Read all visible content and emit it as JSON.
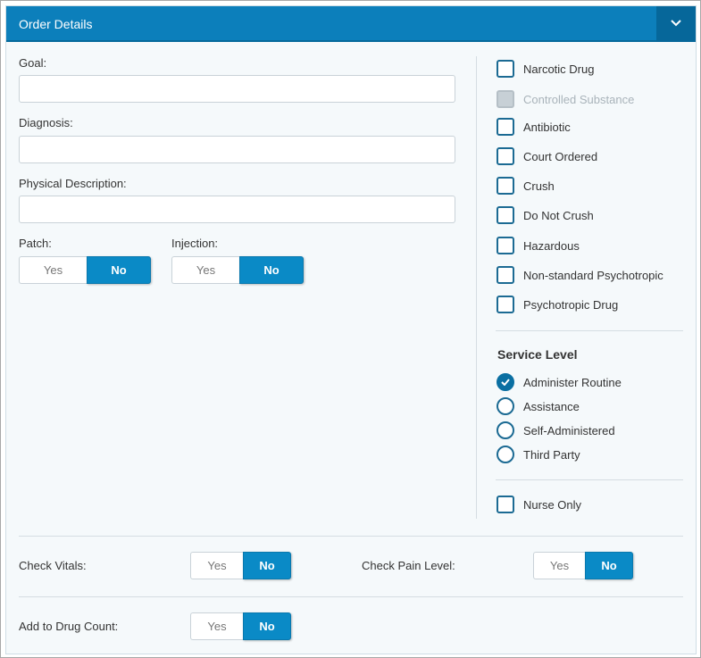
{
  "header": {
    "title": "Order Details",
    "collapse_icon": "chevron-down-icon"
  },
  "fields": {
    "goal": {
      "label": "Goal:",
      "value": ""
    },
    "diagnosis": {
      "label": "Diagnosis:",
      "value": ""
    },
    "physical_description": {
      "label": "Physical Description:",
      "value": ""
    }
  },
  "toggles": {
    "patch": {
      "label": "Patch:",
      "yes": "Yes",
      "no": "No",
      "selected": "No"
    },
    "injection": {
      "label": "Injection:",
      "yes": "Yes",
      "no": "No",
      "selected": "No"
    },
    "check_vitals": {
      "label": "Check Vitals:",
      "yes": "Yes",
      "no": "No",
      "selected": "No"
    },
    "check_pain_level": {
      "label": "Check Pain Level:",
      "yes": "Yes",
      "no": "No",
      "selected": "No"
    },
    "add_to_drug_count": {
      "label": "Add to Drug Count:",
      "yes": "Yes",
      "no": "No",
      "selected": "No"
    }
  },
  "checkboxes": [
    {
      "label": "Narcotic Drug",
      "checked": false,
      "disabled": false
    },
    {
      "label": "Controlled Substance",
      "checked": false,
      "disabled": true
    },
    {
      "label": "Antibiotic",
      "checked": false,
      "disabled": false
    },
    {
      "label": "Court Ordered",
      "checked": false,
      "disabled": false
    },
    {
      "label": "Crush",
      "checked": false,
      "disabled": false
    },
    {
      "label": "Do Not Crush",
      "checked": false,
      "disabled": false
    },
    {
      "label": "Hazardous",
      "checked": false,
      "disabled": false
    },
    {
      "label": "Non-standard Psychotropic",
      "checked": false,
      "disabled": false
    },
    {
      "label": "Psychotropic Drug",
      "checked": false,
      "disabled": false
    }
  ],
  "service_level": {
    "title": "Service Level",
    "options": [
      {
        "label": "Administer Routine",
        "selected": true
      },
      {
        "label": "Assistance",
        "selected": false
      },
      {
        "label": "Self-Administered",
        "selected": false
      },
      {
        "label": "Third Party",
        "selected": false
      }
    ]
  },
  "nurse_only": {
    "label": "Nurse Only",
    "checked": false
  },
  "colors": {
    "header": "#0c7fbb",
    "accent": "#0a8ac6",
    "checkbox_border": "#1b6a93"
  }
}
